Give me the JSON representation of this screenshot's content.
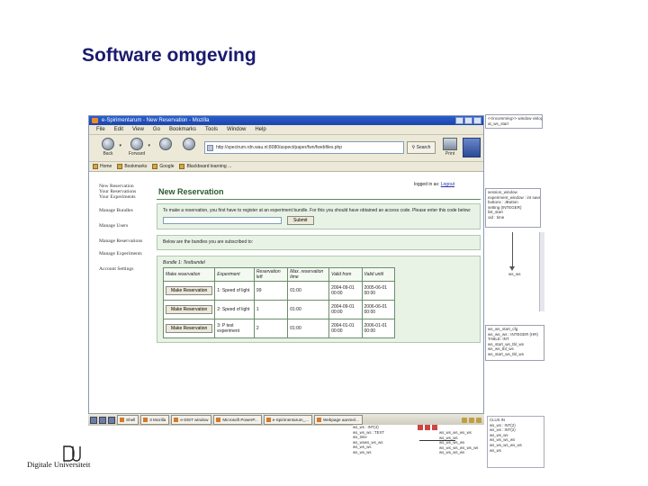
{
  "slide": {
    "title": "Software omgeving"
  },
  "browser": {
    "window_title": "e-Spirimentarum - New Reservation - Mozilla",
    "menu": [
      "File",
      "Edit",
      "View",
      "Go",
      "Bookmarks",
      "Tools",
      "Window",
      "Help"
    ],
    "nav": {
      "back_label": "Back",
      "forward_label": "Forward",
      "url": "http://spectrum.rdn.wau.nl:8080/aspect/paper/fwn/fwebfiles.php",
      "search_label": "Search",
      "print_label": "Print"
    },
    "bookmarks": [
      "Home",
      "Bookmarks",
      "Google",
      "Blackboard learning ..."
    ]
  },
  "page": {
    "sidenav": [
      "New Reservation",
      "Your Reservations",
      "Your Experiments",
      "Manage Bundles",
      "Manage Users",
      "Manage Reservations",
      "Manage Experiments",
      "Account Settings"
    ],
    "login_text": "logged in as: ",
    "logout_label": "Logout",
    "heading": "New Reservation",
    "intro_text": "To make a reservation, you first have to register at an experiment bundle. For this you should have obtained an access code. Please enter this code below:",
    "submit_label": "Submit",
    "subscribed_text": "Below are the bundles you are subscribed to:",
    "bundle_title": "Bundle 1: Testbundel",
    "table": {
      "headers": [
        "Make reservation",
        "Experiment",
        "Reservation left",
        "Max. reservation time",
        "Valid from",
        "Valid until"
      ],
      "rows": [
        {
          "button": "Make Reservation",
          "experiment": "1: Speed of light",
          "left": "99",
          "max": "01:00",
          "from": "2004-09-01 00:00",
          "until": "2005-06-01 00:00"
        },
        {
          "button": "Make Reservation",
          "experiment": "2: Speed of light",
          "left": "1",
          "max": "01:00",
          "from": "2004-09-01 00:00",
          "until": "2006-06-01 00:00"
        },
        {
          "button": "Make Reservation",
          "experiment": "3: P test experiment",
          "left": "2",
          "max": "01:00",
          "from": "2004-01-01 00:00",
          "until": "2006-01-01 00:00"
        }
      ]
    }
  },
  "right_panels": {
    "panel_a": [
      "<<incomming>> window vislogic",
      "at_ws_start"
    ],
    "panel_b": [
      "session_window",
      "experiment_window : int save",
      "buttons : JButton",
      "setting (INTEGER)",
      "list_start",
      "oid : time"
    ],
    "panel_c_label": "ws_ws",
    "panel_d": [
      "ws_ws_start_cfg",
      "ws_ws_ws : INTEGER (HR)",
      "TABLE: INT",
      "ws_start_ws_tbl_ws",
      "ws_ws_tbl_ws",
      "ws_start_ws_tbl_ws"
    ]
  },
  "taskbar": {
    "items": [
      "Shell",
      "3 Mozilla",
      "e-DIST window",
      "Microsoft PowerP...",
      "e-Spirimentarum_...",
      "Webpage aanmel..."
    ]
  },
  "bottom_tool": {
    "mid_left": [
      "ws_ws : INT(4)",
      "ws_ws_ws : TEXT",
      "ws_time",
      "ws_wsws_ws_ws",
      "ws_ws_ws",
      "ws_ws_ws"
    ],
    "mid_right": [
      "ws_ws_ws_ws_ws",
      "ws_ws_ws",
      "ws_ws_ws_ws",
      "ws_ws_ws_ws_ws_ws",
      "ws_ws_ws_ws"
    ],
    "right": [
      "CLUS IN",
      "ws_ws : INT(2)",
      "ws_ws : INT(2)",
      "ws_ws_ws",
      "ws_ws_ws_ws",
      "ws_ws_ws_ws_ws",
      "ws_ws"
    ]
  },
  "logo": {
    "mark": "DU",
    "text": "Digitale Universiteit"
  }
}
